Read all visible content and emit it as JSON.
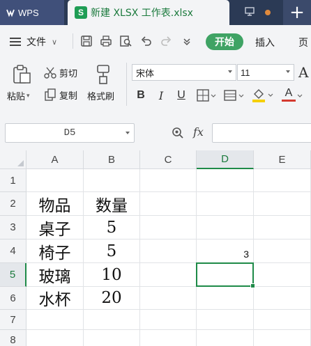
{
  "titlebar": {
    "app_tab": "WPS",
    "doc_tab": "新建 XLSX 工作表.xlsx",
    "doc_icon_letter": "S"
  },
  "menubar": {
    "file": "文件",
    "start": "开始",
    "insert": "插入",
    "page": "页"
  },
  "ribbon": {
    "paste": "粘贴",
    "cut": "剪切",
    "copy": "复制",
    "format_painter": "格式刷",
    "font_name": "宋体",
    "font_size": "11",
    "bold": "B",
    "italic": "I",
    "underline": "U",
    "font_color_letter": "A",
    "grow_font_letter": "A"
  },
  "formula_bar": {
    "name_box": "D5",
    "fx": "fx",
    "formula": ""
  },
  "sheet": {
    "columns": [
      "A",
      "B",
      "C",
      "D",
      "E"
    ],
    "rows": [
      "1",
      "2",
      "3",
      "4",
      "5",
      "6",
      "7",
      "8"
    ],
    "active_cell": "D5",
    "cells": {
      "A2": "物品",
      "B2": "数量",
      "A3": "桌子",
      "B3": "5",
      "A4": "椅子",
      "B4": "5",
      "D4": "3",
      "A5": "玻璃",
      "B5": "10",
      "A6": "水杯",
      "B6": "20"
    }
  },
  "colors": {
    "accent_green": "#3fa364",
    "title_bg": "#2b3a55",
    "selection": "#1e8a48"
  }
}
